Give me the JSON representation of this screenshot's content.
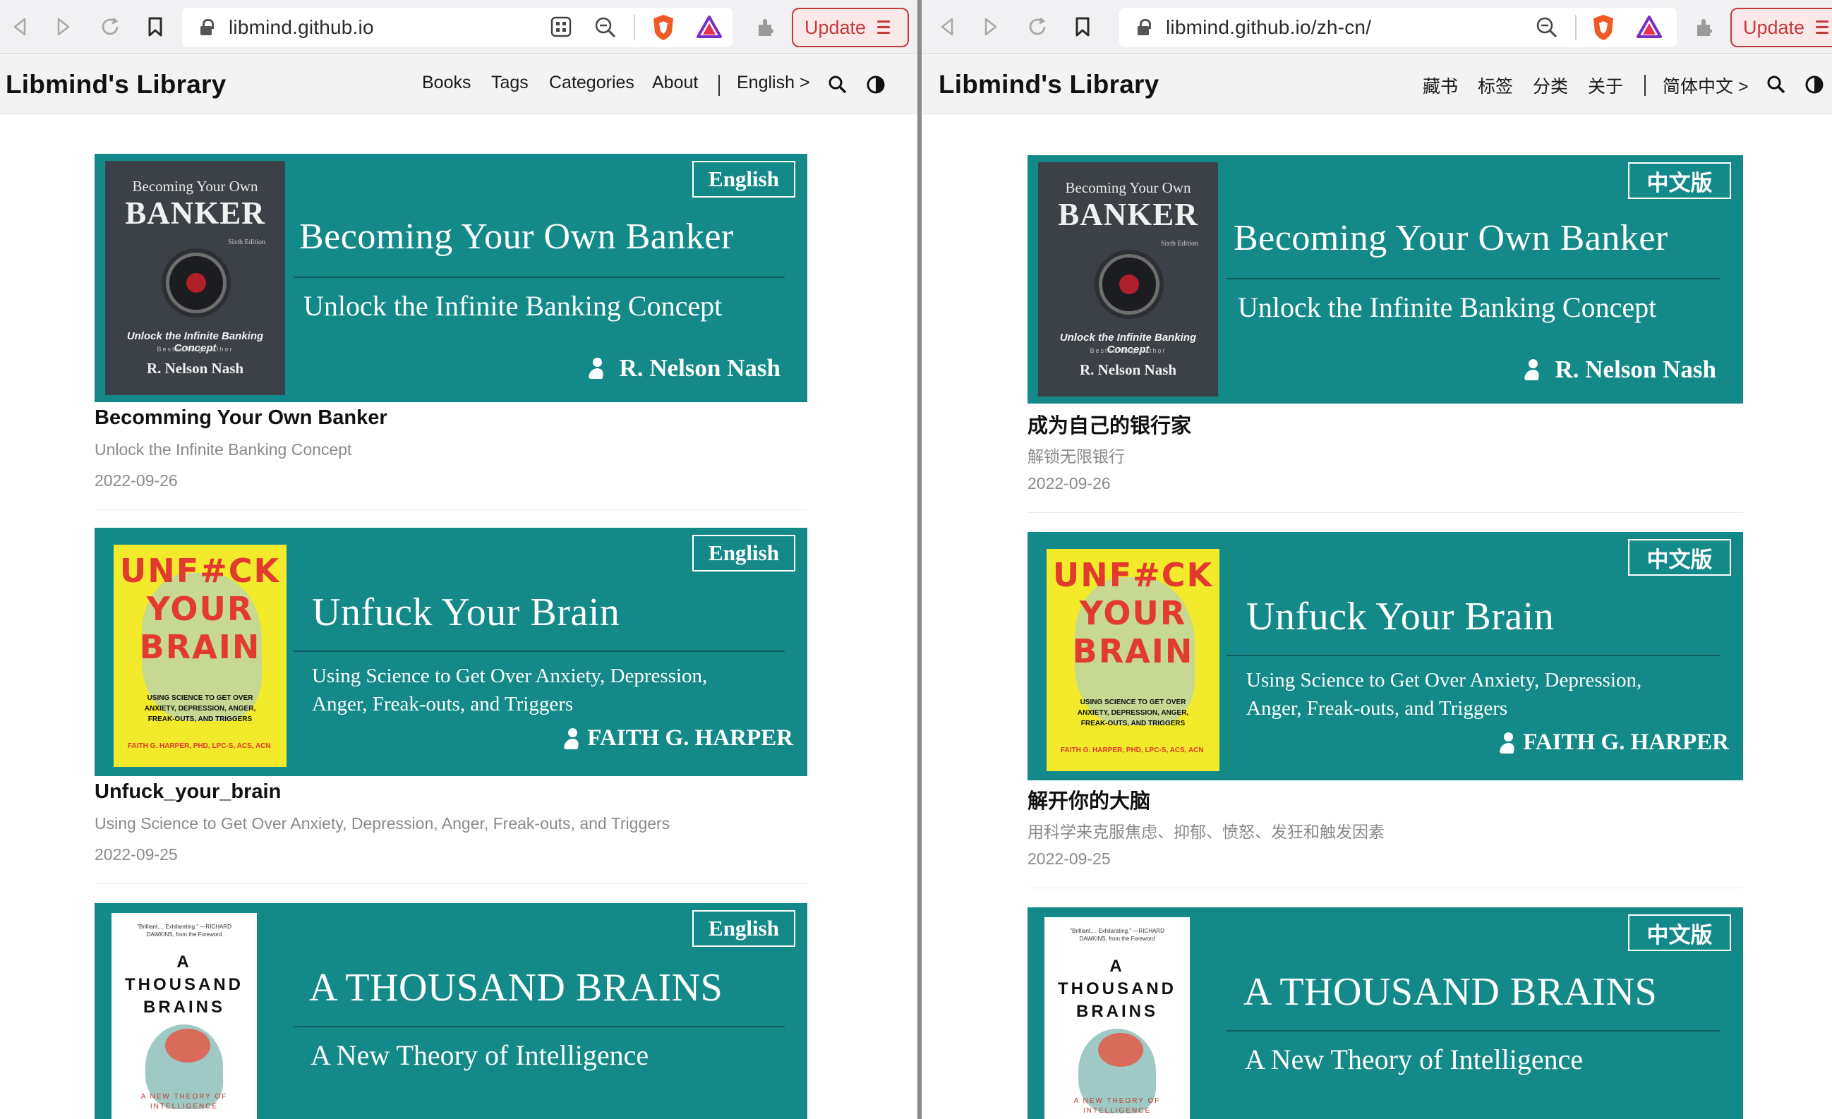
{
  "left": {
    "url": "libmind.github.io",
    "update_label": "Update",
    "brand": "Libmind's Library",
    "menu": [
      "Books",
      "Tags",
      "Categories",
      "About"
    ],
    "lang_switch": "English",
    "lang_switch_arrow": ">",
    "posts": [
      {
        "badge": "English",
        "banner_title": "Becoming  Your Own Banker",
        "banner_subtitle": "Unlock the Infinite Banking Concept",
        "banner_author": "R. Nelson Nash",
        "title": "Becomming Your Own Banker",
        "description": "Unlock the Infinite Banking Concept",
        "date": "2022-09-26"
      },
      {
        "badge": "English",
        "banner_title": "Unfuck Your Brain",
        "banner_subtitle_1": "Using Science to Get Over Anxiety, Depression,",
        "banner_subtitle_2": "Anger, Freak-outs, and Triggers",
        "banner_author": "FAITH G. HARPER",
        "title": "Unfuck_your_brain",
        "description": "Using Science to Get Over Anxiety, Depression, Anger, Freak-outs, and Triggers",
        "date": "2022-09-25"
      },
      {
        "badge": "English",
        "banner_title": "A THOUSAND BRAINS",
        "banner_subtitle": "A New Theory of Intelligence"
      }
    ]
  },
  "right": {
    "url": "libmind.github.io/zh-cn/",
    "update_label": "Update",
    "brand": "Libmind's Library",
    "menu": [
      "藏书",
      "标签",
      "分类",
      "关于"
    ],
    "lang_switch": "简体中文",
    "lang_switch_arrow": ">",
    "posts": [
      {
        "badge": "中文版",
        "banner_title": "Becoming  Your Own Banker",
        "banner_subtitle": "Unlock the Infinite Banking Concept",
        "banner_author": "R. Nelson Nash",
        "title": "成为自己的银行家",
        "description": "解锁无限银行",
        "date": "2022-09-26"
      },
      {
        "badge": "中文版",
        "banner_title": "Unfuck Your Brain",
        "banner_subtitle_1": "Using Science to Get Over Anxiety, Depression,",
        "banner_subtitle_2": "Anger, Freak-outs, and Triggers",
        "banner_author": "FAITH G. HARPER",
        "title": "解开你的大脑",
        "description": "用科学来克服焦虑、抑郁、愤怒、发狂和触发因素",
        "date": "2022-09-25"
      },
      {
        "badge": "中文版",
        "banner_title": "A THOUSAND BRAINS",
        "banner_subtitle": "A New Theory of Intelligence"
      }
    ]
  },
  "covers": {
    "banker": {
      "line1": "Becoming Your Own",
      "line2": "BANKER",
      "edition": "Sixth Edition",
      "tagline": "Unlock the Infinite Banking Concept",
      "badge": "Bestselling Author",
      "author": "R. Nelson Nash"
    },
    "unfuck": {
      "line1": "UNF#CK",
      "line2": "YOUR",
      "line3": "BRAIN",
      "small": "USING SCIENCE TO GET OVER ANXIETY, DEPRESSION, ANGER, FREAK-OUTS, AND TRIGGERS",
      "author": "FAITH G. HARPER, PHD, LPC-S, ACS, ACN"
    },
    "thousand": {
      "quote": "\"Brilliant.... Exhilarating.\" —RICHARD DAWKINS, from the Foreword",
      "line1": "A",
      "line2": "THOUSAND",
      "line3": "BRAINS",
      "small": "A NEW THEORY OF INTELLIGENCE"
    }
  },
  "colors": {
    "banner_bg": "#138a89",
    "update_red": "#c23a3a",
    "nav_bg": "#f3f3f3"
  },
  "icons": [
    "back-icon",
    "forward-icon",
    "reload-icon",
    "bookmark-icon",
    "lock-icon",
    "qr-code-icon",
    "zoom-out-icon",
    "brave-shield-icon",
    "brave-rewards-icon",
    "extensions-icon",
    "search-icon",
    "theme-toggle-icon",
    "author-icon"
  ]
}
